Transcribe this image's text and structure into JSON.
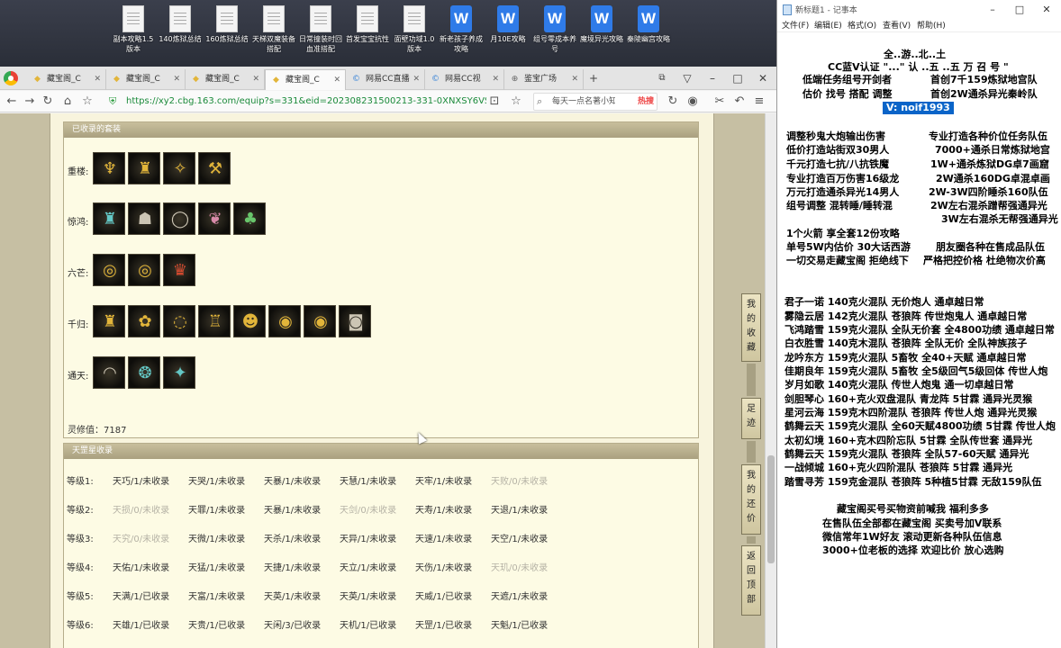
{
  "desktop": {
    "icons": [
      {
        "label": "副本攻略1.5版本",
        "kind": "doc"
      },
      {
        "label": "140炼狱总结",
        "kind": "doc"
      },
      {
        "label": "160炼狱总结",
        "kind": "doc"
      },
      {
        "label": "天梯双魔装备搭配",
        "kind": "doc"
      },
      {
        "label": "日常撞装时回血准搭配",
        "kind": "doc"
      },
      {
        "label": "首发宝宝抗性",
        "kind": "doc"
      },
      {
        "label": "面壁功域1.0版本",
        "kind": "doc"
      },
      {
        "label": "新老孩子养成攻略",
        "kind": "wps"
      },
      {
        "label": "月10E攻略",
        "kind": "wps"
      },
      {
        "label": "组号零成本养号",
        "kind": "wps"
      },
      {
        "label": "魔境异光攻略",
        "kind": "wps"
      },
      {
        "label": "秦陵幽宫攻略",
        "kind": "wps"
      }
    ]
  },
  "browser": {
    "tabs": [
      {
        "label": "藏宝阁_C",
        "active": false
      },
      {
        "label": "藏宝阁_C",
        "active": false
      },
      {
        "label": "藏宝阁_C",
        "active": false
      },
      {
        "label": "藏宝阁_C",
        "active": true
      },
      {
        "label": "网易CC直播",
        "active": false
      },
      {
        "label": "网易CC视",
        "active": false
      },
      {
        "label": "鉴宝广场",
        "active": false
      }
    ],
    "url": "https://xy2.cbg.163.com/equip?s=331&eid=202308231500213-331-0XNXSY6VSLAH&",
    "search_placeholder": "每天一点名著小知",
    "search_hot": "热搜"
  },
  "page": {
    "equip_panel": {
      "title": "已收录的套装",
      "rows": [
        {
          "label": "重楼:",
          "items": [
            "lamp-icon",
            "robe-icon",
            "hairpin-icon",
            "claw-icon"
          ]
        },
        {
          "label": "惊鸿:",
          "items": [
            "armor-icon",
            "helm-icon",
            "ring-icon",
            "feather-icon",
            "mask-icon"
          ]
        },
        {
          "label": "六芒:",
          "items": [
            "lantern-icon",
            "lantern-icon",
            "crown-icon"
          ]
        },
        {
          "label": "千归:",
          "items": [
            "robe-icon",
            "flower-icon",
            "necklace-icon",
            "cloak-icon",
            "mask-icon",
            "ring-icon",
            "ring-icon",
            "bracer-icon"
          ]
        },
        {
          "label": "通天:",
          "items": [
            "necklace-icon",
            "bead-icon",
            "staff-icon"
          ]
        }
      ],
      "value_text": "灵修值：7187"
    },
    "collect_panel": {
      "title": "天罡星收录",
      "rows": [
        {
          "level": "等级1:",
          "cells": [
            {
              "t": "天巧/1/未收录",
              "dim": false
            },
            {
              "t": "天哭/1/未收录",
              "dim": false
            },
            {
              "t": "天暴/1/未收录",
              "dim": false
            },
            {
              "t": "天慧/1/未收录",
              "dim": false
            },
            {
              "t": "天牢/1/未收录",
              "dim": false
            },
            {
              "t": "天败/0/未收录",
              "dim": true
            }
          ]
        },
        {
          "level": "等级2:",
          "cells": [
            {
              "t": "天损/0/未收录",
              "dim": true
            },
            {
              "t": "天罪/1/未收录",
              "dim": false
            },
            {
              "t": "天暴/1/未收录",
              "dim": false
            },
            {
              "t": "天剑/0/未收录",
              "dim": true
            },
            {
              "t": "天寿/1/未收录",
              "dim": false
            },
            {
              "t": "天退/1/未收录",
              "dim": false
            }
          ]
        },
        {
          "level": "等级3:",
          "cells": [
            {
              "t": "天究/0/未收录",
              "dim": true
            },
            {
              "t": "天微/1/未收录",
              "dim": false
            },
            {
              "t": "天杀/1/未收录",
              "dim": false
            },
            {
              "t": "天异/1/未收录",
              "dim": false
            },
            {
              "t": "天速/1/未收录",
              "dim": false
            },
            {
              "t": "天空/1/未收录",
              "dim": false
            }
          ]
        },
        {
          "level": "等级4:",
          "cells": [
            {
              "t": "天佑/1/未收录",
              "dim": false
            },
            {
              "t": "天猛/1/未收录",
              "dim": false
            },
            {
              "t": "天捷/1/未收录",
              "dim": false
            },
            {
              "t": "天立/1/未收录",
              "dim": false
            },
            {
              "t": "天伤/1/未收录",
              "dim": false
            },
            {
              "t": "天玑/0/未收录",
              "dim": true
            }
          ]
        },
        {
          "level": "等级5:",
          "cells": [
            {
              "t": "天满/1/已收录",
              "dim": false
            },
            {
              "t": "天富/1/未收录",
              "dim": false
            },
            {
              "t": "天英/1/未收录",
              "dim": false
            },
            {
              "t": "天英/1/未收录",
              "dim": false
            },
            {
              "t": "天威/1/已收录",
              "dim": false
            },
            {
              "t": "天遮/1/未收录",
              "dim": false
            }
          ]
        },
        {
          "level": "等级6:",
          "cells": [
            {
              "t": "天雄/1/已收录",
              "dim": false
            },
            {
              "t": "天贵/1/已收录",
              "dim": false
            },
            {
              "t": "天闲/3/已收录",
              "dim": false
            },
            {
              "t": "天机/1/已收录",
              "dim": false
            },
            {
              "t": "天罡/1/已收录",
              "dim": false
            },
            {
              "t": "天魁/1/已收录",
              "dim": false
            }
          ]
        }
      ]
    },
    "side_buttons": [
      {
        "label": "我的收藏",
        "chars": [
          "我",
          "的",
          "收",
          "藏"
        ]
      },
      {
        "label": "足迹",
        "chars": [
          "足",
          "迹"
        ]
      },
      {
        "label": "我的还价",
        "chars": [
          "我",
          "的",
          "还",
          "价"
        ]
      },
      {
        "label": "返回顶部",
        "chars": [
          "返",
          "回",
          "顶",
          "部"
        ]
      }
    ]
  },
  "notepad": {
    "title": "新标题1 - 记事本",
    "menu": [
      "文件(F)",
      "编辑(E)",
      "格式(O)",
      "查看(V)",
      "帮助(H)"
    ],
    "lines": [
      "全..游..北..土",
      "CC蓝V认证 \"...\" 认 ..五 ..五 万 召 号 \"",
      "低端任务组号开剑者",
      "首创7千159炼狱地宫队",
      "估价 找号 搭配 调整",
      "首创2W通杀异光秦岭队",
      "V:  noif1993",
      "调整秒鬼大炮输出伤害",
      "专业打造各种价位任务队伍",
      "低价打造站街双30男人",
      "7000+通杀日常炼狱地宫",
      "千元打造七抗/八抗铁魔",
      "1W+通杀炼狱DG卓7画窟",
      "专业打造百万伤害16级龙",
      "2W通杀160DG卓混卓画",
      "万元打造通杀异光14男人",
      "2W-3W四阶睡杀160队伍",
      "组号调整 混转睡/睡转混",
      "2W左右混杀蹭帮强通异光",
      "3W左右混杀无帮强通异光",
      "1个火箭 享全套12份攻略",
      "单号5W内估价 30大话西游",
      "朋友圈各种在售成品队伍",
      "一切交易走藏宝阁 拒绝线下",
      "严格把控价格 杜绝物次价高",
      "君子一诺 140克火混队 无价炮人 通卓越日常",
      "雾隐云居 142克火混队 苍狼阵 传世炮鬼人 通卓越日常",
      "飞鸿踏雪 159克火混队 全队无价套 全4800功绩 通卓越日常",
      "白衣胜雪 140克木混队 苍狼阵 全队无价 全队神族孩子",
      "龙吟东方 159克火混队 5畜牧 全40+天赋 通卓越日常",
      "佳期良年 159克火混队 5畜牧 全5级回气5级回体 传世人炮",
      "岁月如歌 140克火混队 传世人炮鬼 通一切卓越日常",
      "剑胆琴心 160+克火双盘混队 青龙阵 5甘霖 通异光灵猴",
      "星河云海 159克木四阶混队 苍狼阵 传世人炮 通异光灵猴",
      "鹤舞云天 159克火混队 全60天赋4800功绩 5甘霖 传世人炮",
      "太初幻境 160+克木四阶忘队 5甘霖 全队传世套 通异光",
      "鹤舞云天 159克火混队 苍狼阵 全队57-60天赋 通异光",
      "一战倾城 160+克火四阶混队 苍狼阵 5甘霖 通异光",
      "踏雪寻芳 159克金混队 苍狼阵 5种植5甘霖 无敌159队伍",
      "藏宝阁买号买物资前喊我 福利多多",
      "在售队伍全部都在藏宝阁 买卖号加V联系",
      "微信常年1W好友 滚动更新各种队伍信息",
      "3000+位老板的选择 欢迎比价 放心选购"
    ]
  }
}
